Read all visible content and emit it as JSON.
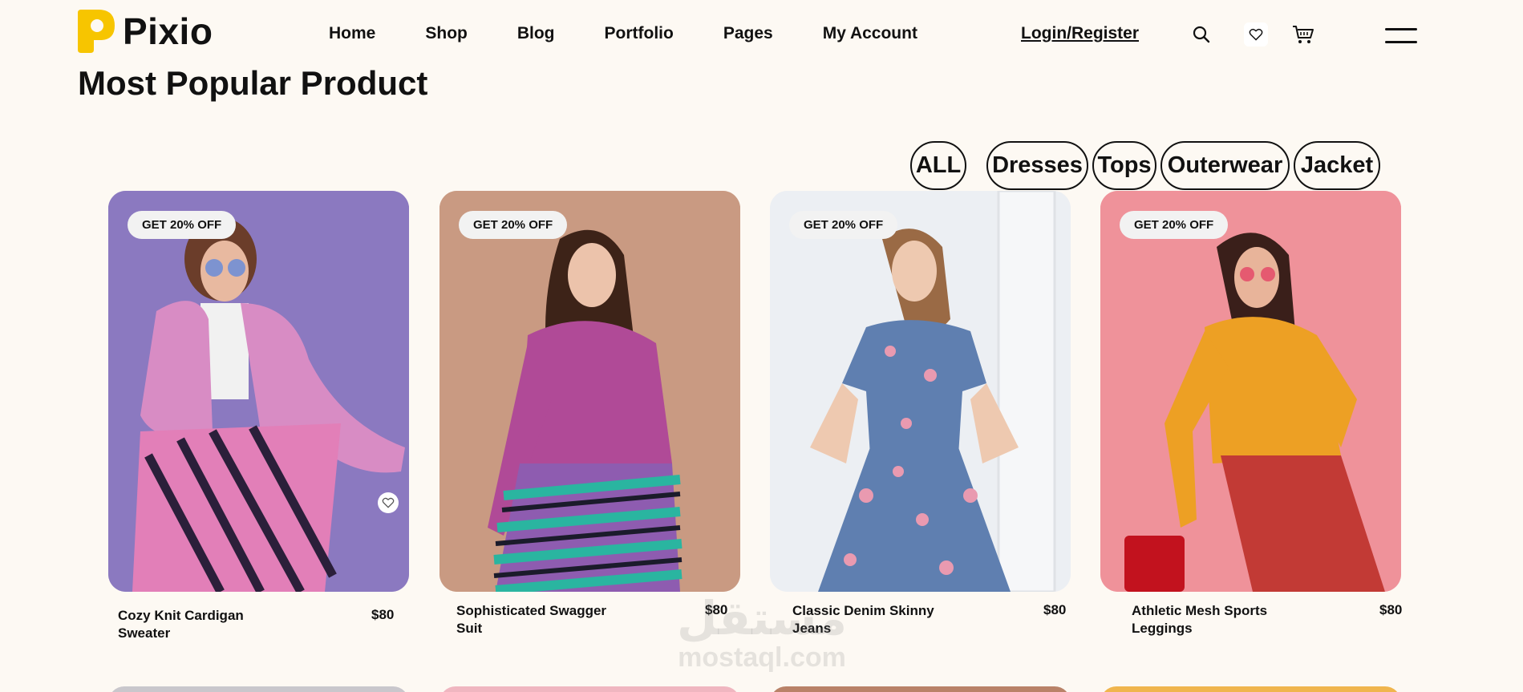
{
  "brand": {
    "name": "Pixio",
    "accent": "#f7c500"
  },
  "nav": [
    "Home",
    "Shop",
    "Blog",
    "Portfolio",
    "Pages",
    "My Account"
  ],
  "header": {
    "login": "Login/Register",
    "icons": [
      "search-icon",
      "heart-icon",
      "cart-icon",
      "menu-icon"
    ]
  },
  "section": {
    "title": "Most Popular Product"
  },
  "filters": [
    "ALL",
    "Dresses",
    "Tops",
    "Outerwear",
    "Jacket"
  ],
  "products": [
    {
      "badge": "GET 20% OFF",
      "name": "Cozy Knit Cardigan Sweater",
      "price": "$80",
      "bg": "#8b79c0"
    },
    {
      "badge": "GET 20% OFF",
      "name": "Sophisticated Swagger Suit",
      "price": "$80",
      "bg": "#c99a82"
    },
    {
      "badge": "GET 20% OFF",
      "name": "Classic Denim Skinny Jeans",
      "price": "$80",
      "bg": "#eceff3"
    },
    {
      "badge": "GET 20% OFF",
      "name": "Athletic Mesh Sports Leggings",
      "price": "$80",
      "bg": "#ef929a"
    }
  ],
  "watermark": {
    "arabic": "مستقل",
    "latin": "mostaql.com"
  }
}
